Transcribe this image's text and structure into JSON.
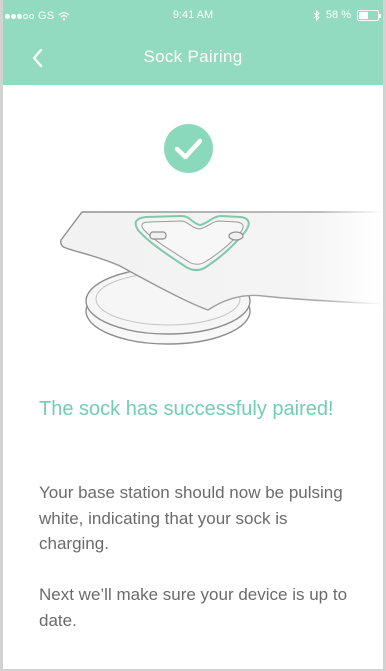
{
  "status_bar": {
    "carrier": "GS",
    "time": "9:41 AM",
    "battery_text": "58 %",
    "battery_level": 0.58,
    "signal_bars_filled": 3,
    "signal_bars_total": 5
  },
  "nav": {
    "title": "Sock Pairing",
    "back_icon": "chevron-left-icon"
  },
  "icons": {
    "success": "checkmark-circle-icon",
    "wifi": "wifi-icon",
    "bluetooth": "bluetooth-icon",
    "battery": "battery-icon"
  },
  "colors": {
    "accent": "#92dbc0",
    "accent_text": "#6fcfae",
    "check_circle": "#8ad9bc",
    "body_text": "#6b6b6b",
    "background": "#ffffff"
  },
  "content": {
    "headline": "The sock has successfuly paired!",
    "paragraph_1": "Your base station should now be pulsing white, indicating that your sock is charging.",
    "paragraph_2": "Next we’ll make sure your device is up to date."
  }
}
